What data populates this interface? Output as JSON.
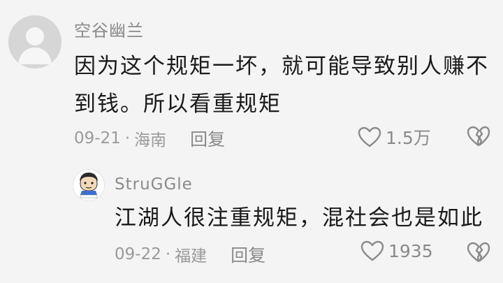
{
  "comment": {
    "username": "空谷幽兰",
    "text": "因为这个规矩一坏，就可能导致别人赚不到钱。所以看重规矩",
    "date": "09-21",
    "separator": "·",
    "location": "海南",
    "reply_label": "回复",
    "like_count": "1.5万"
  },
  "reply": {
    "username": "StruGGle",
    "text": "江湖人很注重规矩，混社会也是如此",
    "date": "09-22",
    "separator": "·",
    "location": "福建",
    "reply_label": "回复",
    "like_count": "1935"
  },
  "icons": {
    "like": "heart-outline-icon",
    "dislike": "broken-heart-icon",
    "default_avatar": "default-avatar-icon"
  },
  "colors": {
    "background": "#f4f4f4",
    "text_primary": "#1a1a1a",
    "text_secondary": "#8a8a8a"
  }
}
